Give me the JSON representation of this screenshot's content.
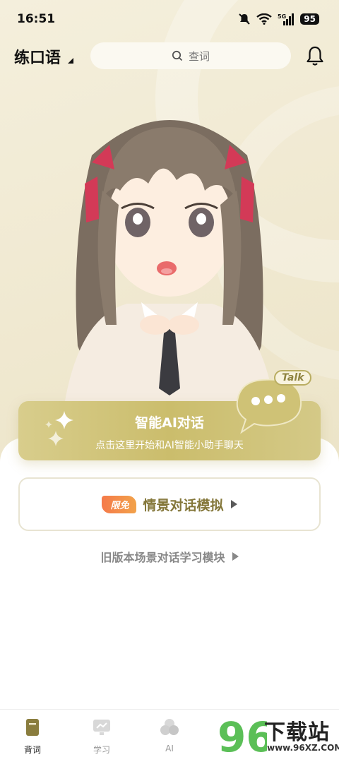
{
  "status_bar": {
    "time": "16:51",
    "battery": "95",
    "network": "5G"
  },
  "header": {
    "title": "练口语",
    "search_placeholder": "查词",
    "icons": [
      "search-icon",
      "bell-icon"
    ]
  },
  "ai_chat": {
    "title": "智能AI对话",
    "subtitle": "点击这里开始和AI智能小助手聊天",
    "tag": "Talk"
  },
  "scenario": {
    "badge": "限免",
    "label": "情景对话模拟"
  },
  "legacy_link": {
    "label": "旧版本场景对话学习模块"
  },
  "tabs": [
    {
      "label": "背词",
      "active": true,
      "icon": "book-icon"
    },
    {
      "label": "学习",
      "active": false,
      "icon": "monitor-chart-icon"
    },
    {
      "label": "AI",
      "active": false,
      "icon": "ai-circles-icon"
    }
  ],
  "watermark": {
    "brand": "下载站",
    "number": "96",
    "url": "www.96XZ.COM"
  },
  "colors": {
    "accent": "#cbbd6c",
    "accent_text": "#84773a",
    "badge": "#f57a4a",
    "background": "#f1ead3"
  }
}
